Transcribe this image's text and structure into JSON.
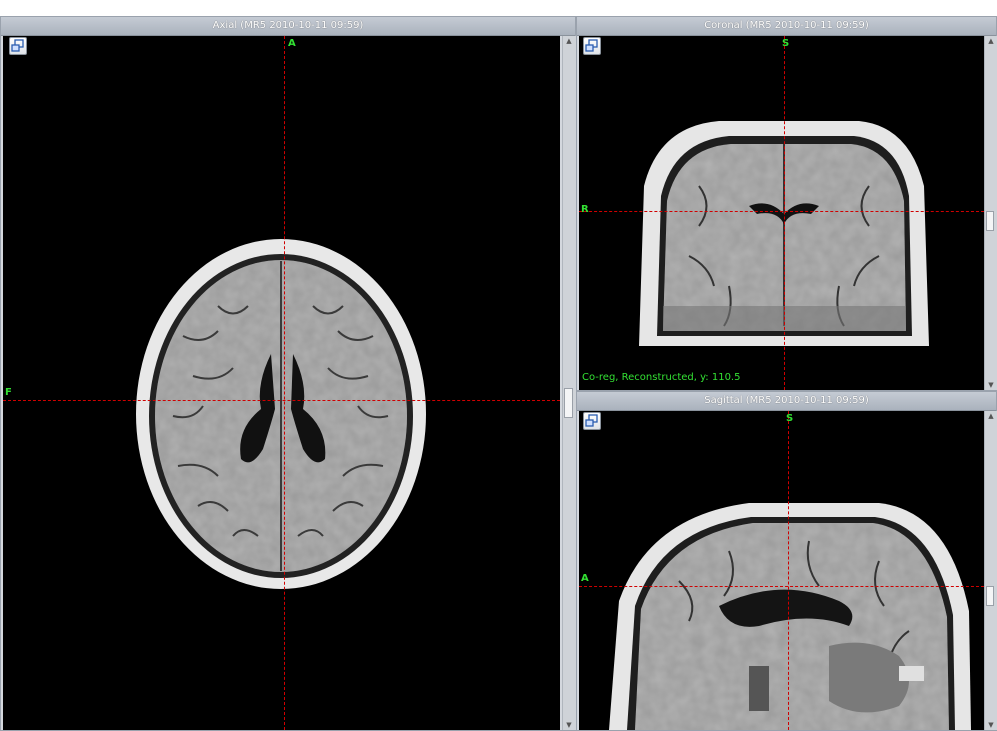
{
  "axial": {
    "title": "Axial (MR5 2010-10-11 09:59)",
    "orientation_top": "A",
    "orientation_left": "F"
  },
  "coronal": {
    "title": "Coronal (MR5 2010-10-11 09:59)",
    "orientation_top": "S",
    "orientation_left": "R",
    "status": "Co-reg, Reconstructed, y: 110.5"
  },
  "sagittal": {
    "title": "Sagittal (MR5 2010-10-11 09:59)",
    "orientation_top": "S",
    "orientation_left": "A"
  },
  "icons": {
    "view_button": "window-layout-icon",
    "scroll_up": "arrow-up-icon",
    "scroll_down": "arrow-down-icon"
  },
  "colors": {
    "orientation_label": "#33e033",
    "crosshair": "#d00000",
    "viewport_bg": "#000000"
  }
}
